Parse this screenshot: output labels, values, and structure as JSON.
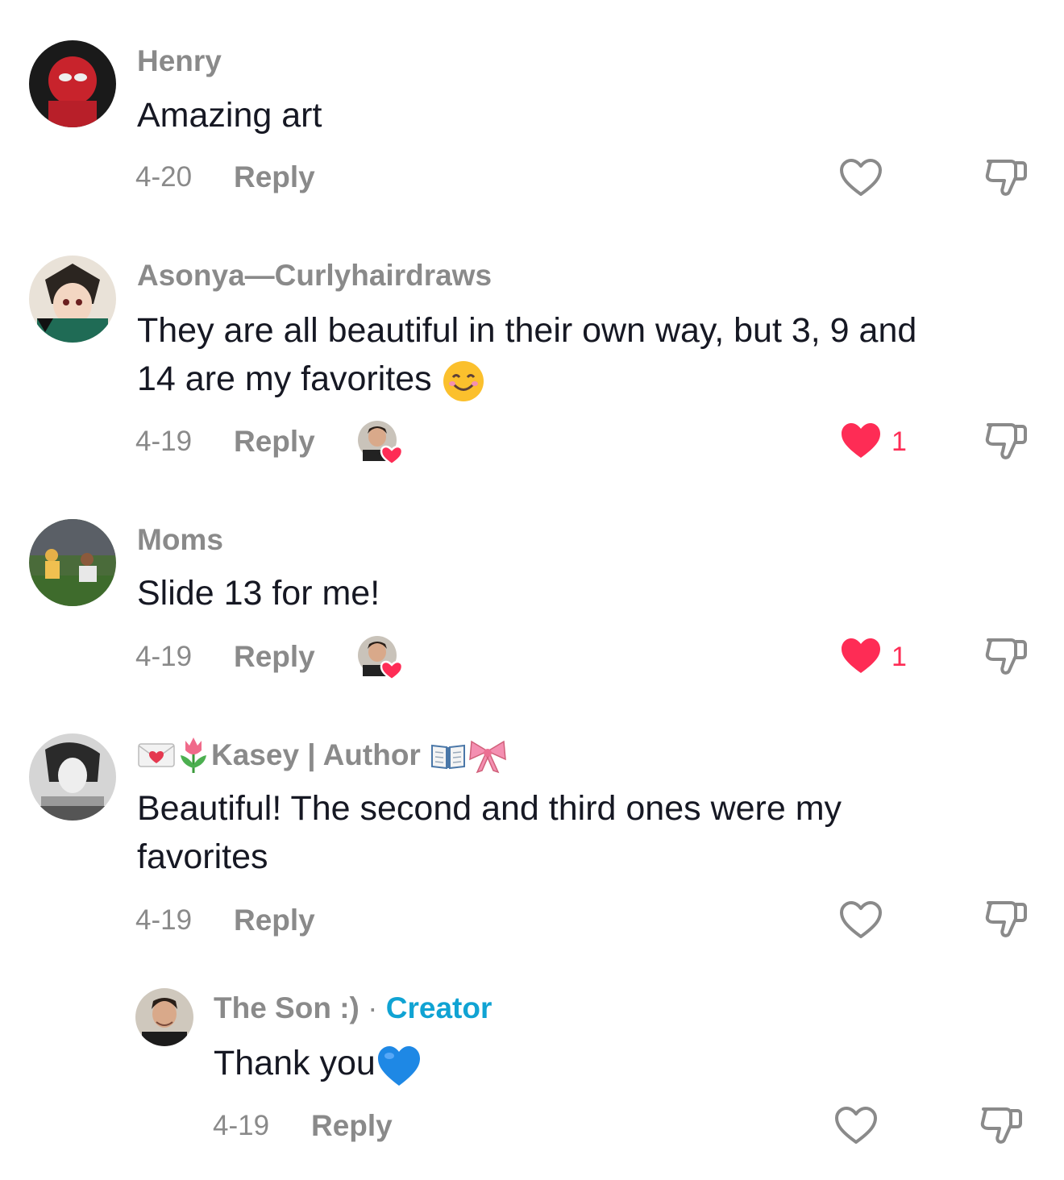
{
  "comments": [
    {
      "username": "Henry",
      "text": "Amazing art",
      "date": "4-20",
      "reply_label": "Reply",
      "liked": false,
      "like_count": ""
    },
    {
      "username": "Asonya—Curlyhairdraws",
      "text": "They are all beautiful in their own way, but 3, 9 and\n14 are my favorites",
      "text_emoji": "smiling-face-icon",
      "date": "4-19",
      "reply_label": "Reply",
      "creator_liked": true,
      "liked": true,
      "like_count": "1"
    },
    {
      "username": "Moms",
      "text": "Slide 13 for me!",
      "date": "4-19",
      "reply_label": "Reply",
      "creator_liked": true,
      "liked": true,
      "like_count": "1"
    },
    {
      "username_prefix_emojis": [
        "love-letter-icon",
        "tulip-icon"
      ],
      "username": "Kasey | Author",
      "username_suffix_emojis": [
        "open-book-icon",
        "ribbon-icon"
      ],
      "text": "Beautiful! The second and third ones were my\nfavorites",
      "date": "4-19",
      "reply_label": "Reply",
      "liked": false,
      "like_count": ""
    }
  ],
  "reply": {
    "username": "The Son :)",
    "separator": "·",
    "badge": "Creator",
    "text": "Thank you",
    "text_emoji": "blue-heart-icon",
    "date": "4-19",
    "reply_label": "Reply",
    "liked": false
  },
  "colors": {
    "text": "#161823",
    "muted": "#8a8a8a",
    "like_red": "#fe2c55",
    "creator_blue": "#10a3d3"
  }
}
